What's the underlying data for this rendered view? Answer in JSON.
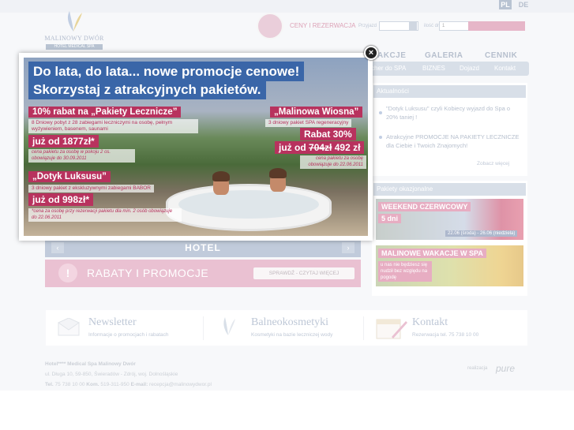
{
  "lang": {
    "pl": "PL",
    "de": "DE"
  },
  "logo": {
    "name": "MALINOWY DWÓR",
    "sub": "HOTEL MEDICAL SPA"
  },
  "reservation": {
    "label": "CENY I REZERWACJA",
    "arrival_label": "Przyjazd",
    "arrival_value": "",
    "days_label": "ilość dni",
    "days_value": "1"
  },
  "nav": {
    "items": [
      "AKCJE",
      "GALERIA",
      "CENNIK"
    ]
  },
  "subnav": {
    "items": [
      "cher do SPA",
      "BIZNES",
      "Dojazd",
      "Kontakt"
    ]
  },
  "aktualnosci": {
    "title": "Aktualności",
    "items": [
      "\"Dotyk Luksusu\" czyli Kobiecy wyjazd do Spa o 20% taniej !",
      "Atrakcyjne PROMOCJE NA PAKIETY LECZNICZE dla Ciebie i Twoich Znajomych!"
    ],
    "more": "Zobacz więcej"
  },
  "pakiety": {
    "title": "Pakiety okazjonalne",
    "promo1": {
      "title": "WEEKEND CZERWCOWY",
      "days": "5 dni",
      "dates": "22.06 (środa) - 26.06 (niedziela)"
    },
    "promo2": {
      "title": "MALINOWE WAKACJE W SPA",
      "text": "u nas nie będziesz się nudził bez względu na pogodę"
    }
  },
  "hotel_bar": {
    "label": "HOTEL",
    "prev": "‹",
    "next": "›"
  },
  "rabaty": {
    "icon": "!",
    "label": "RABATY I PROMOCJE",
    "button": "SPRAWDŹ - CZYTAJ WIĘCEJ"
  },
  "footer_links": {
    "newsletter": {
      "title": "Newsletter",
      "sub": "Informacje o promocjach i rabatach"
    },
    "balneo": {
      "title": "Balneokosmetyki",
      "sub": "Kosmetyki na bazie leczniczej wody"
    },
    "kontakt": {
      "title": "Kontakt",
      "sub": "Rezerwacja tel. 75 738 10 00"
    }
  },
  "address": {
    "name": "Hotel**** Medical Spa Malinowy Dwór",
    "street": "ul. Długa 10, 59-850, Świeradów - Zdrój, woj. Dolnośląskie",
    "tel_label": "Tel.",
    "tel": "75 738 10 00",
    "kom_label": "Kom.",
    "kom": "519-311-950",
    "email_label": "E-mail:",
    "email": "recepcja@malinowydwor.pl"
  },
  "credits": {
    "label": "realizacja",
    "brand": "pure"
  },
  "modal": {
    "close": "×",
    "headline1": "Do lata, do lata... nowe promocje cenowe!",
    "headline2": "Skorzystaj z atrakcyjnych pakietów.",
    "offer1": {
      "title": "10% rabat na „Pakiety Lecznicze”",
      "desc": "8 Dniowy pobyt z 28 zabiegami leczniczymi na osobę, pełnym wyżywieniem, basenem, saunami",
      "price": "już od 1877zł*",
      "note": "cena pakietu za osobę w pokoju 2 os. obowiązuje do 30.09.2011"
    },
    "offer2": {
      "title": "„Dotyk Luksusu”",
      "desc": "3 dniowy pakiet z ekskluzywnymi zabiegami BABOR",
      "price": "już od 998zł*",
      "note": "*cena za osobę przy rezerwacji pakietu dla min. 2 osób obowiązuje do 22.06.2011"
    },
    "offer3": {
      "title": "„Malinowa Wiosna”",
      "desc": "3 dniowy pakiet SPA regeneracyjny",
      "discount": "Rabat 30%",
      "price_prefix": "już od",
      "old_price": "704zł",
      "new_price": "492 zł",
      "note": "cena pakietu za osobę obowiązuje do 22.06.2011"
    }
  }
}
